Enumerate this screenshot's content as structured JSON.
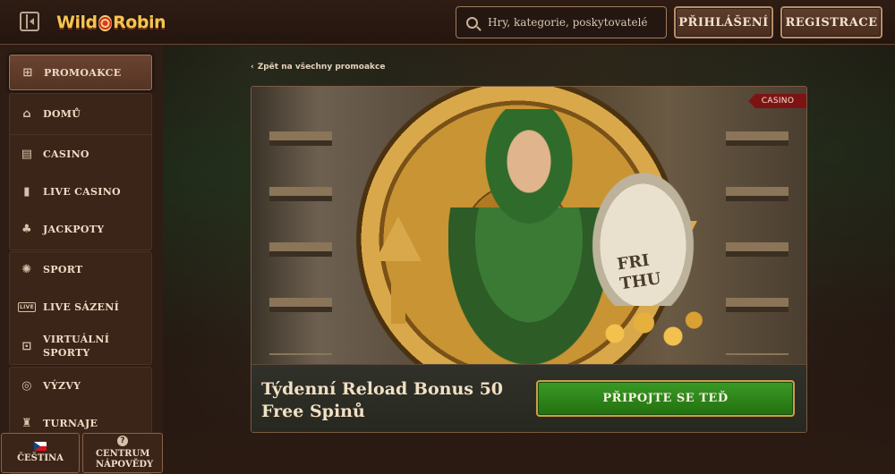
{
  "header": {
    "logo_text_1": "Wild",
    "logo_text_2": "Robin",
    "search_placeholder": "Hry, kategorie, poskytovatelé",
    "login_label": "PŘIHLÁŠENÍ",
    "register_label": "REGISTRACE"
  },
  "sidebar": {
    "items": [
      {
        "label": "PROMOAKCE",
        "icon": "gift-icon",
        "active": true
      },
      {
        "label": "DOMŮ",
        "icon": "home-icon"
      },
      {
        "label": "CASINO",
        "icon": "slot-machine-icon"
      },
      {
        "label": "LIVE CASINO",
        "icon": "cards-icon"
      },
      {
        "label": "JACKPOTY",
        "icon": "clover-icon"
      },
      {
        "label": "SPORT",
        "icon": "soccer-ball-icon"
      },
      {
        "label": "LIVE SÁZENÍ",
        "icon": "live-icon"
      },
      {
        "label": "VIRTUÁLNÍ SPORTY",
        "icon": "virtual-sports-icon"
      },
      {
        "label": "VÝZVY",
        "icon": "target-icon"
      },
      {
        "label": "TURNAJE",
        "icon": "trophy-icon"
      }
    ],
    "language_label": "ČEŠTINA",
    "help_label": "CENTRUM NÁPOVĚDY"
  },
  "main": {
    "back_link": "Zpět na všechny promoakce",
    "badge": "CASINO",
    "sack_text": "FRI THU",
    "promo_title": "Týdenní Reload Bonus 50 Free Spinů",
    "cta_label": "PŘIPOJTE SE TEĎ"
  },
  "colors": {
    "background": "#2a1a12",
    "accent_gold": "#f2c14e",
    "cta_green": "#3a9a26",
    "badge_red": "#7d1414"
  }
}
